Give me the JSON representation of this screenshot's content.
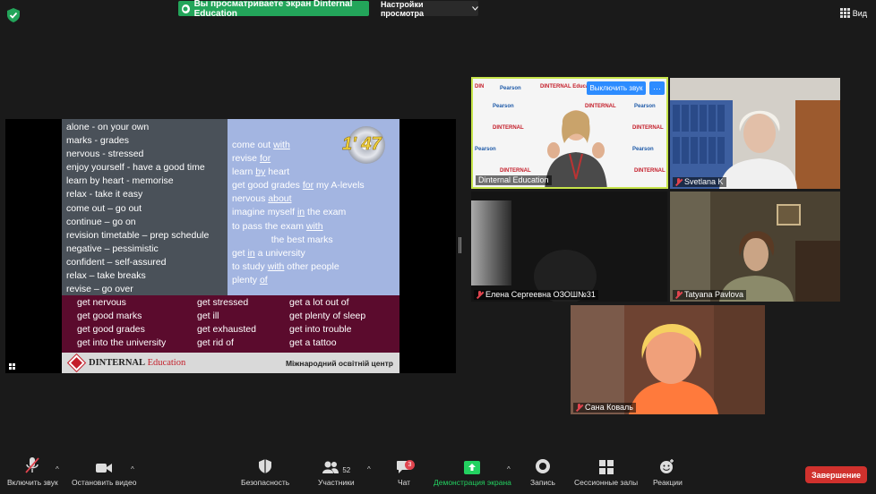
{
  "top_bar": {
    "banner_text": "Вы просматриваете экран Dinternal Education",
    "view_options": "Настройки просмотра",
    "view_button": "Вид"
  },
  "slide": {
    "left_lines": [
      "alone - on your own",
      "marks - grades",
      "nervous - stressed",
      "enjoy yourself - have a good time",
      "learn by heart - memorise",
      "relax - take it easy",
      "come out – go out",
      "continue – go on",
      "revision timetable – prep schedule",
      "negative – pessimistic",
      "confident – self-assured",
      "relax – take breaks",
      "revise – go over"
    ],
    "timer": "1' 47",
    "right_lines": [
      {
        "pre": "come out ",
        "u": "with",
        "post": ""
      },
      {
        "pre": "revise ",
        "u": "for",
        "post": ""
      },
      {
        "pre": "learn ",
        "u": "by",
        "post": " heart"
      },
      {
        "pre": "get good grades ",
        "u": "for",
        "post": " my A-levels"
      },
      {
        "pre": "nervous ",
        "u": "about",
        "post": ""
      },
      {
        "pre": "imagine myself ",
        "u": "in",
        "post": " the exam"
      },
      {
        "pre": "to pass the exam ",
        "u": "with",
        "post": ""
      },
      {
        "pre": "               the best marks",
        "u": "",
        "post": ""
      },
      {
        "pre": "get ",
        "u": "in",
        "post": " a university"
      },
      {
        "pre": "to study ",
        "u": "with",
        "post": " other people"
      },
      {
        "pre": "plenty ",
        "u": "of",
        "post": ""
      }
    ],
    "maroon_col1": [
      "get nervous",
      "get good marks",
      "get good grades",
      "get into the university"
    ],
    "maroon_col2": [
      "get stressed",
      "get ill",
      "get exhausted",
      "get rid of"
    ],
    "maroon_col3": [
      "get a lot out of",
      "get plenty of sleep",
      "get into trouble",
      "get a tattoo"
    ],
    "logo_main": "DINTERNAL",
    "logo_sub": "Education",
    "footer_label": "Міжнародний освітній центр"
  },
  "participants": {
    "host": {
      "name": "Dinternal Education",
      "unmute": "Выключить звук",
      "more": "···",
      "brand_red": "DINTERNAL Education",
      "brand_blue": "Pearson"
    },
    "p2": {
      "name": "Svetlana K"
    },
    "p3": {
      "name": "Елена Сергеевна ОЗОШ№31"
    },
    "p4": {
      "name": "Tatyana Pavlova"
    },
    "p5": {
      "name": "Сана Коваль"
    }
  },
  "toolbar": {
    "mute": "Включить звук",
    "video": "Остановить видео",
    "security": "Безопасность",
    "participants": "Участники",
    "participants_count": "52",
    "chat": "Чат",
    "chat_badge": "3",
    "share": "Демонстрация экрана",
    "record": "Запись",
    "breakout": "Сессионные залы",
    "reactions": "Реакции",
    "end": "Завершение"
  },
  "colors": {
    "banner": "#23a55a",
    "active_speaker": "#c6e44a",
    "unmute_button": "#2d8cff",
    "end_button": "#d0312d",
    "slide_left": "#4a5159",
    "slide_right": "#a3b5e1",
    "slide_band": "#5b0b2d"
  }
}
